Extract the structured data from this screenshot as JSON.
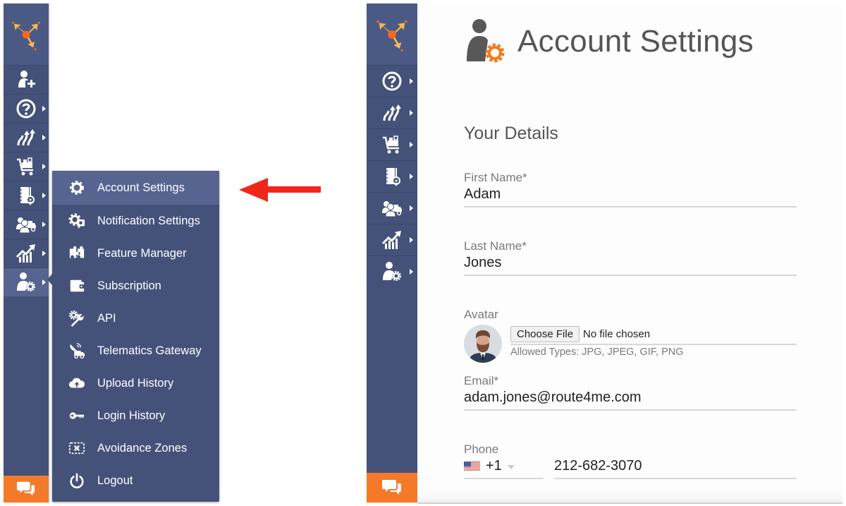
{
  "left_panel": {
    "sidebar": {
      "items": [
        {
          "icon": "add-user-icon",
          "has_submenu": false
        },
        {
          "icon": "help-icon",
          "has_submenu": true
        },
        {
          "icon": "routes-icon",
          "has_submenu": true
        },
        {
          "icon": "cart-icon",
          "has_submenu": true
        },
        {
          "icon": "address-book-icon",
          "has_submenu": true
        },
        {
          "icon": "team-vehicle-icon",
          "has_submenu": true
        },
        {
          "icon": "analytics-icon",
          "has_submenu": true
        },
        {
          "icon": "user-settings-icon",
          "has_submenu": true,
          "active": true
        }
      ],
      "chat_icon": "chat-icon"
    },
    "flyout_menu": {
      "items": [
        {
          "label": "Account Settings",
          "icon": "gear-icon",
          "active": true
        },
        {
          "label": "Notification Settings",
          "icon": "notification-gear-icon"
        },
        {
          "label": "Feature Manager",
          "icon": "puzzle-icon"
        },
        {
          "label": "Subscription",
          "icon": "wallet-icon"
        },
        {
          "label": "API",
          "icon": "wrench-gear-icon"
        },
        {
          "label": "Telematics Gateway",
          "icon": "satellite-truck-icon"
        },
        {
          "label": "Upload History",
          "icon": "cloud-upload-icon"
        },
        {
          "label": "Login History",
          "icon": "key-icon"
        },
        {
          "label": "Avoidance Zones",
          "icon": "avoidance-zone-icon"
        },
        {
          "label": "Logout",
          "icon": "power-icon"
        }
      ]
    }
  },
  "annotation": {
    "arrow_color": "#f0261d",
    "direction": "left"
  },
  "right_panel": {
    "sidebar": {
      "items": [
        {
          "icon": "help-icon",
          "has_submenu": true
        },
        {
          "icon": "routes-icon",
          "has_submenu": true
        },
        {
          "icon": "cart-icon",
          "has_submenu": true
        },
        {
          "icon": "address-book-icon",
          "has_submenu": true
        },
        {
          "icon": "team-vehicle-icon",
          "has_submenu": true
        },
        {
          "icon": "analytics-icon",
          "has_submenu": true
        },
        {
          "icon": "user-settings-icon",
          "has_submenu": true
        }
      ]
    },
    "page": {
      "title": "Account Settings",
      "section_title": "Your Details",
      "fields": {
        "first_name": {
          "label": "First Name*",
          "value": "Adam"
        },
        "last_name": {
          "label": "Last Name*",
          "value": "Jones"
        },
        "avatar": {
          "label": "Avatar",
          "choose_button": "Choose File",
          "file_status": "No file chosen",
          "allowed_types": "Allowed Types: JPG, JPEG, GIF, PNG"
        },
        "email": {
          "label": "Email*",
          "value": "adam.jones@route4me.com"
        },
        "phone": {
          "label": "Phone",
          "country_code": "+1",
          "country": "US",
          "value": "212-682-3070"
        }
      }
    }
  },
  "colors": {
    "sidebar": "#44527a",
    "sidebar_active": "#56648f",
    "accent_orange": "#f47a2a",
    "arrow_red": "#f0261d"
  }
}
